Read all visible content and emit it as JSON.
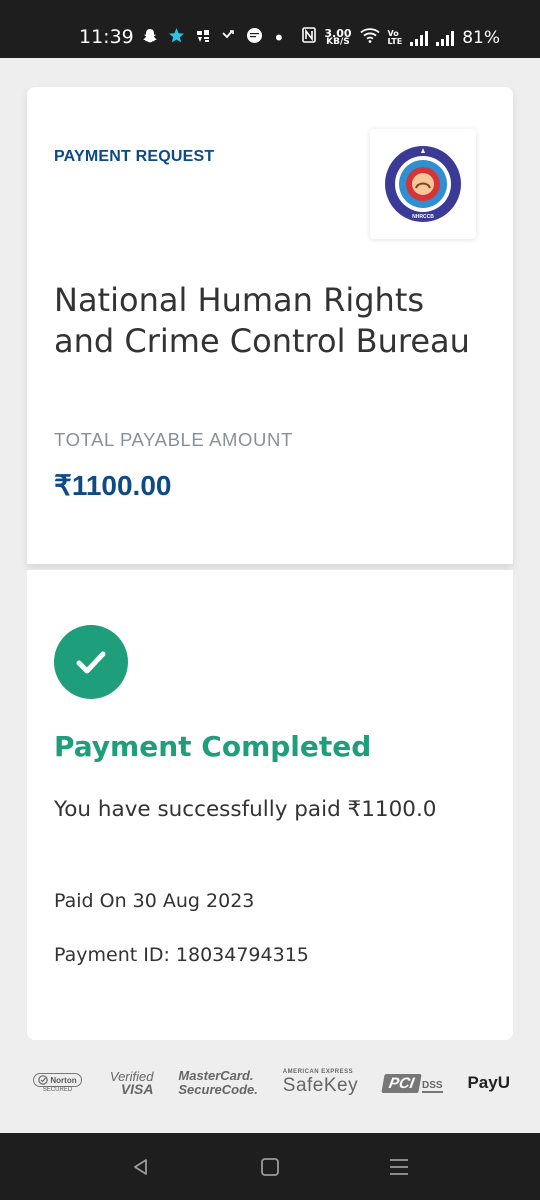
{
  "status_bar": {
    "time": "11:39",
    "data_speed_value": "3.00",
    "data_speed_unit": "KB/S",
    "volte_top": "Vo",
    "volte_bottom": "LTE",
    "battery": "81%",
    "icons": [
      "snapchat-icon",
      "star-icon",
      "app-icon",
      "missed-call-icon",
      "chat-icon",
      "dot-icon",
      "nfc-icon",
      "wifi-icon",
      "signal-icon",
      "signal-icon"
    ]
  },
  "summary": {
    "badge": "PAYMENT REQUEST",
    "merchant_name": "National Human Rights and Crime Control Bureau",
    "logo_caption": "NHRCCB",
    "total_label": "TOTAL PAYABLE AMOUNT",
    "amount": "₹1100.00"
  },
  "result": {
    "icon": "check-icon",
    "title": "Payment Completed",
    "message": "You have successfully paid ₹1100.0",
    "paid_on": "Paid On 30 Aug 2023",
    "payment_id": "Payment ID: 18034794315"
  },
  "trust_logos": {
    "norton": "Norton",
    "norton_sub": "SECURED",
    "verified": "Verified",
    "visa": "VISA",
    "mastercard": "MasterCard.",
    "securecode": "SecureCode.",
    "amex": "AMERICAN EXPRESS",
    "safekey": "SafeKey",
    "pci": "PCI",
    "dss": "DSS",
    "payu": "PayU"
  },
  "nav_bar": {
    "icons": [
      "back-icon",
      "home-icon",
      "recents-icon"
    ]
  },
  "colors": {
    "brand_blue": "#0d4a86",
    "success_green": "#1f9e7c"
  }
}
